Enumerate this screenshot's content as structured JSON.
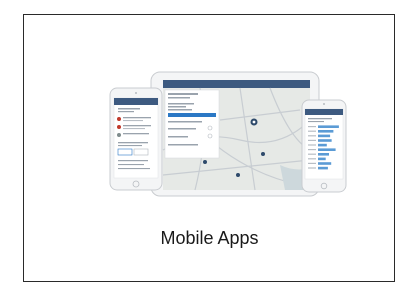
{
  "slide": {
    "caption": "Mobile Apps"
  },
  "colors": {
    "frame_border": "#2a2a2a",
    "device_body": "#f4f5f6",
    "device_bezel": "#c9ccd0",
    "header_bar": "#3d5a80",
    "accent_blue": "#2b78c5",
    "map_bg": "#e6e9e6",
    "map_road": "#c8cdd2",
    "map_water": "#cdd8dc",
    "bar_color": "#5b9bd5"
  },
  "icons": {
    "map_pin": "map-pin-icon",
    "home_button": "home-button-icon"
  },
  "bar_chart_values": [
    0.95,
    0.7,
    0.55,
    0.62,
    0.4,
    0.8,
    0.5,
    0.35,
    0.6,
    0.45
  ]
}
